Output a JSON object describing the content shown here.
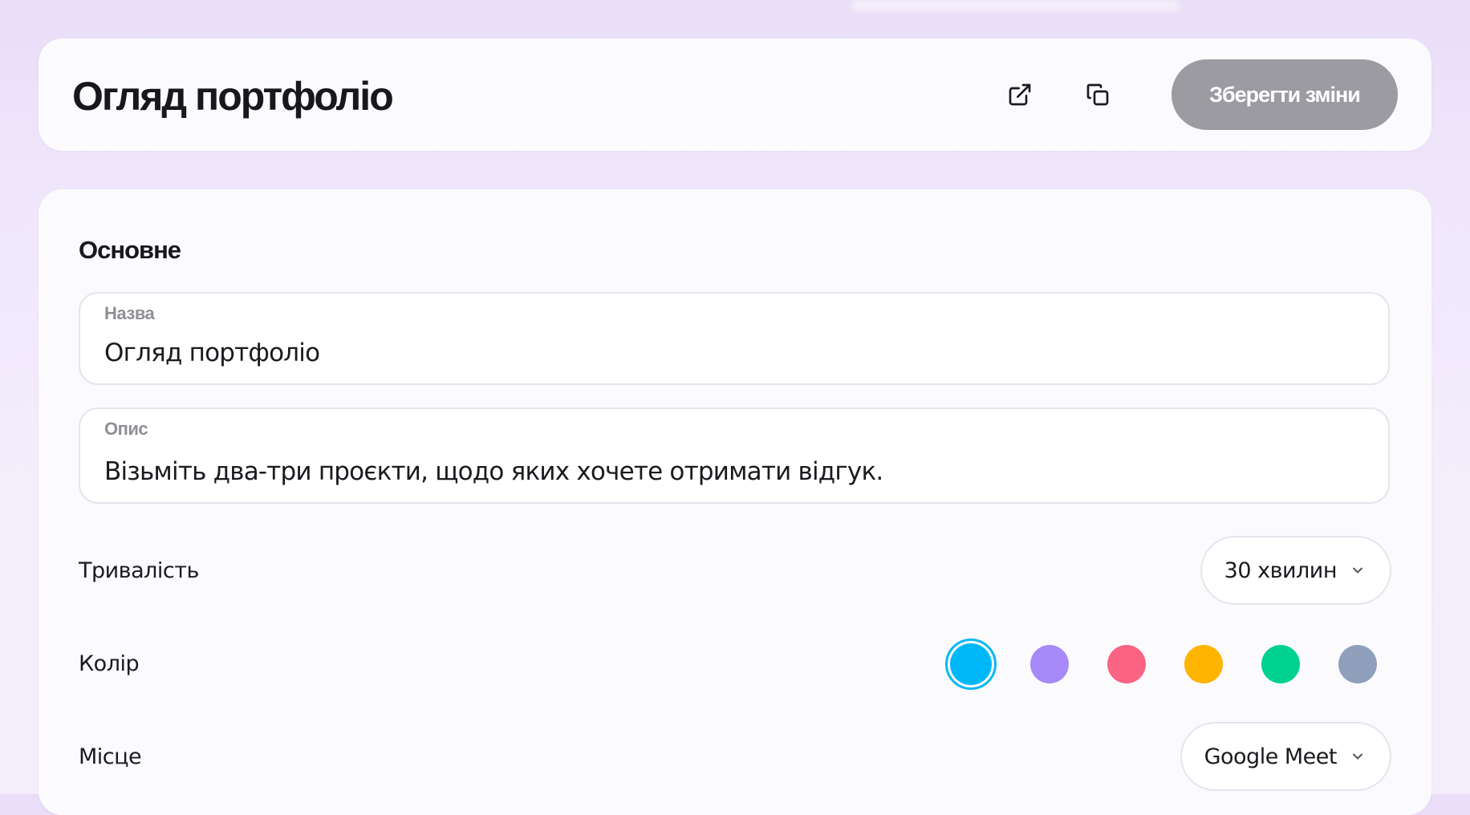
{
  "header": {
    "title": "Огляд портфоліо",
    "open_icon": "external-link-icon",
    "copy_icon": "copy-icon",
    "save_label": "Зберегти зміни"
  },
  "section": {
    "title": "Основне"
  },
  "fields": {
    "name": {
      "label": "Назва",
      "value": "Огляд портфоліо"
    },
    "description": {
      "label": "Опис",
      "value": "Візьміть два-три проєкти, щодо яких хочете отримати відгук."
    }
  },
  "duration": {
    "label": "Тривалість",
    "selected": "30 хвилин"
  },
  "color": {
    "label": "Колір",
    "swatches": [
      "#00b8f7",
      "#a789f7",
      "#fb6383",
      "#ffb400",
      "#00d18c",
      "#8f9fbc"
    ],
    "selected_index": 0
  },
  "location": {
    "label": "Місце",
    "selected": "Google Meet"
  },
  "colors": {
    "save_button_bg": "#9c9ba1",
    "selected_ring": "#0ab8f5"
  }
}
